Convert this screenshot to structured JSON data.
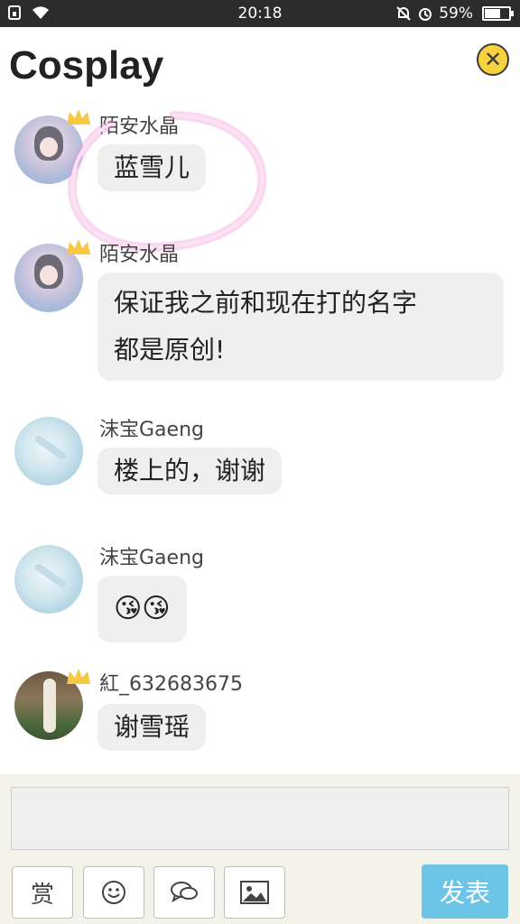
{
  "status_bar": {
    "time": "20:18",
    "battery": "59%",
    "battery_level": 0.59
  },
  "header": {
    "title": "Cosplay",
    "close_icon": "close-icon",
    "accent_color": "#f7d23e"
  },
  "messages": [
    {
      "name": "陌安水晶",
      "text": "蓝雪儿",
      "avatar": "anime",
      "crowned": true
    },
    {
      "name": "陌安水晶",
      "text_lines": [
        "保证我之前和现在打的名字",
        "都是原创!"
      ],
      "avatar": "anime",
      "crowned": true
    },
    {
      "name": "沫宝Gaeng",
      "text": "楼上的，谢谢",
      "avatar": "blue",
      "crowned": false
    },
    {
      "name": "沫宝Gaeng",
      "text": "😘😘",
      "avatar": "blue",
      "crowned": false
    },
    {
      "name": "紅_632683675",
      "text": "谢雪瑶",
      "avatar": "photo",
      "crowned": true
    }
  ],
  "composer": {
    "reward_label": "赏",
    "send_label": "发表",
    "send_color": "#6cc5e6",
    "tools": [
      "reward",
      "emoji-icon",
      "chat-icon",
      "image-icon"
    ]
  }
}
